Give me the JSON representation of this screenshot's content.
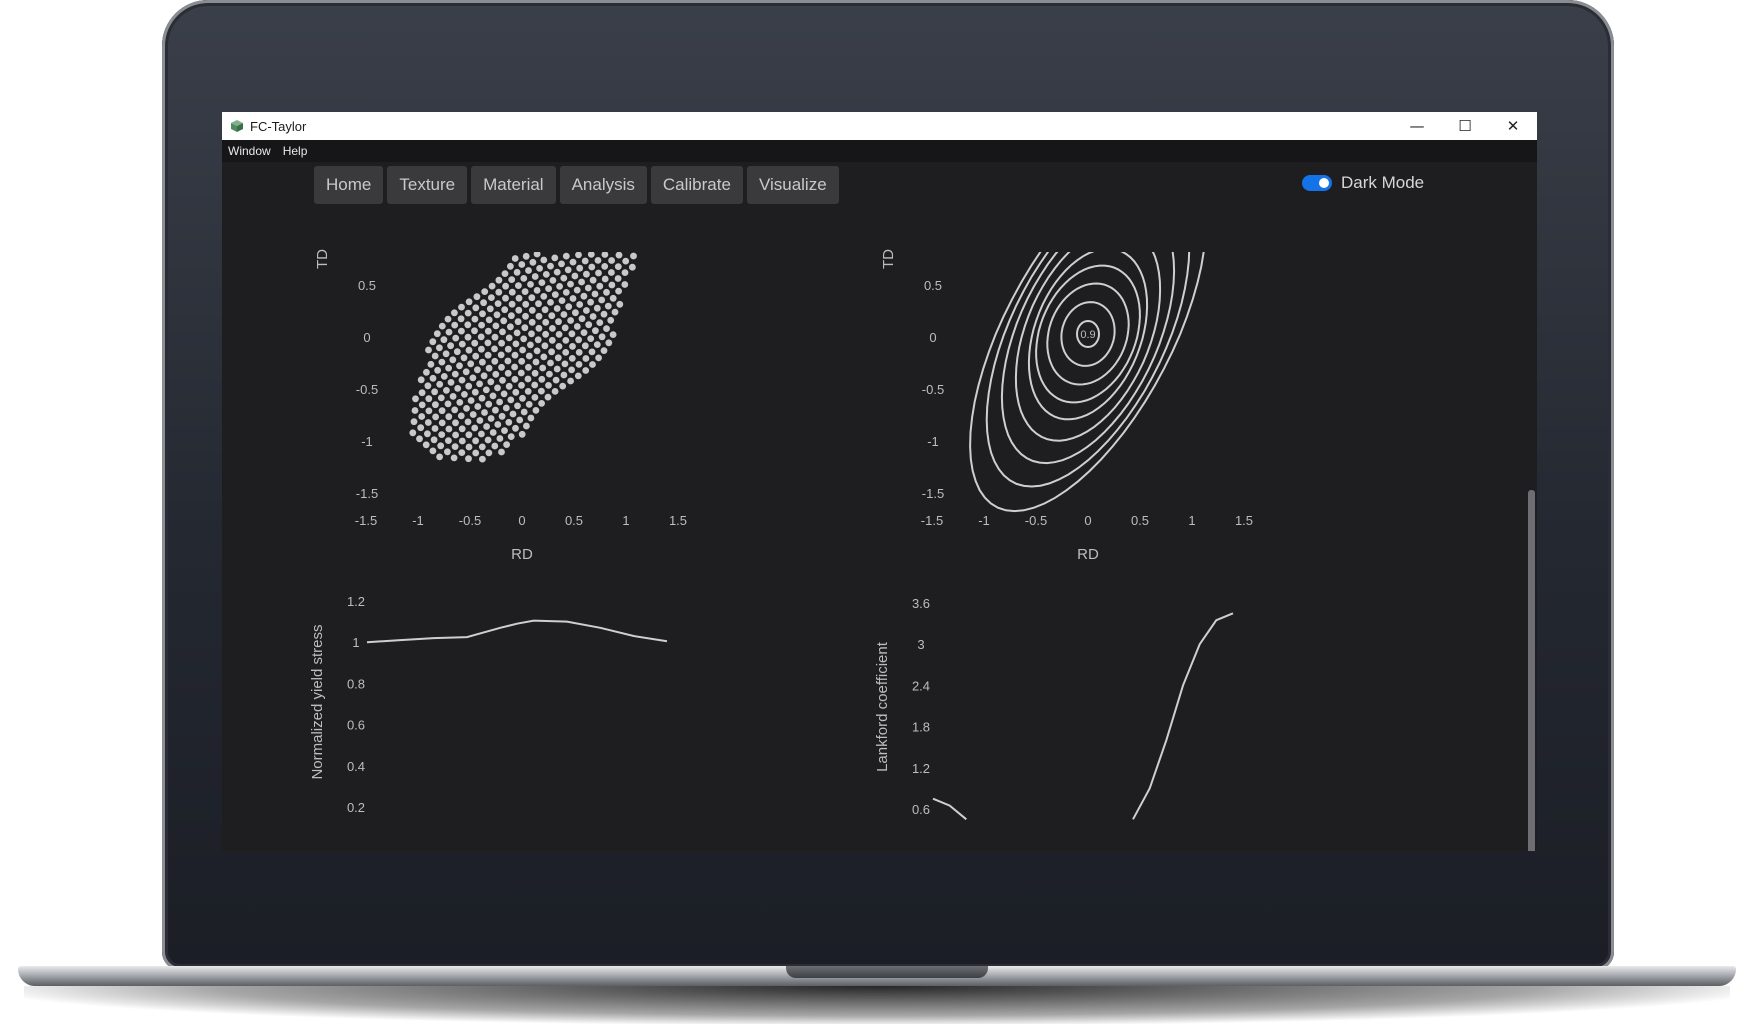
{
  "window": {
    "title": "FC-Taylor",
    "controls": {
      "minimize": "—",
      "maximize": "☐",
      "close": "✕"
    }
  },
  "menu": [
    "Window",
    "Help"
  ],
  "tabs": [
    "Home",
    "Texture",
    "Material",
    "Analysis",
    "Calibrate",
    "Visualize"
  ],
  "dark_mode": {
    "label": "Dark Mode",
    "on": true
  },
  "colors": {
    "accent": "#1473e6",
    "background": "#1e1e20",
    "plot_line": "#cfcfcf"
  },
  "chart_data": [
    {
      "type": "scatter",
      "description_name": "texture-point-plot",
      "xlabel": "RD",
      "ylabel": "TD",
      "xticks": [
        "-1.5",
        "-1",
        "-0.5",
        "0",
        "0.5",
        "1",
        "1.5"
      ],
      "yticks": [
        "0.5",
        "0",
        "-0.5",
        "-1",
        "-1.5"
      ],
      "xlim": [
        -1.5,
        1.5
      ],
      "ylim": [
        -1.5,
        0.9
      ]
    },
    {
      "type": "line",
      "description_name": "yield-contour-plot",
      "xlabel": "RD",
      "ylabel": "TD",
      "xticks": [
        "-1.5",
        "-1",
        "-0.5",
        "0",
        "0.5",
        "1",
        "1.5"
      ],
      "yticks": [
        "0.5",
        "0",
        "-0.5",
        "-1",
        "-1.5"
      ],
      "xlim": [
        -1.5,
        1.5
      ],
      "ylim": [
        -1.5,
        0.9
      ],
      "annotation": "0.9",
      "contour_levels": 9
    },
    {
      "type": "line",
      "description_name": "normalized-yield-stress-plot",
      "ylabel": "Normalized yield stress",
      "yticks": [
        "1.2",
        "1",
        "0.8",
        "0.6",
        "0.4",
        "0.2"
      ],
      "ylim": [
        0.2,
        1.2
      ],
      "x": [
        0,
        10,
        20,
        30,
        40,
        45,
        50,
        60,
        70,
        80,
        90
      ],
      "values": [
        1.0,
        1.01,
        1.02,
        1.025,
        1.07,
        1.09,
        1.105,
        1.1,
        1.07,
        1.03,
        1.005
      ]
    },
    {
      "type": "line",
      "description_name": "lankford-coefficient-plot",
      "ylabel": "Lankford coefficient",
      "yticks": [
        "3.6",
        "3",
        "2.4",
        "1.8",
        "1.2",
        "0.6"
      ],
      "ylim": [
        0.6,
        3.6
      ],
      "x": [
        0,
        5,
        10,
        60,
        65,
        70,
        75,
        80,
        85,
        90
      ],
      "values": [
        0.75,
        0.65,
        0.45,
        0.45,
        0.9,
        1.6,
        2.4,
        3.0,
        3.35,
        3.45
      ]
    }
  ]
}
